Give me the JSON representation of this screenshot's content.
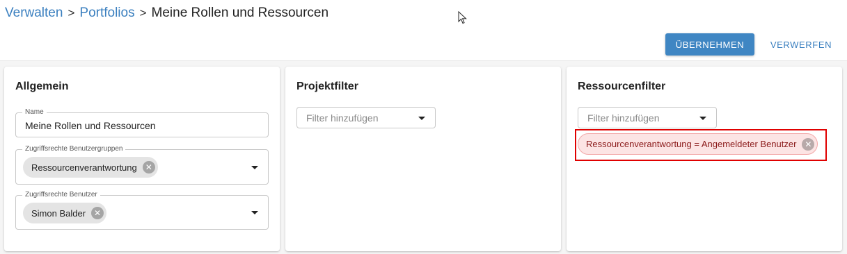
{
  "breadcrumb": {
    "items": [
      "Verwalten",
      "Portfolios"
    ],
    "separator": ">",
    "current": "Meine Rollen und Ressourcen"
  },
  "actions": {
    "apply_label": "ÜBERNEHMEN",
    "discard_label": "VERWERFEN"
  },
  "cards": {
    "general": {
      "title": "Allgemein",
      "name_field": {
        "label": "Name",
        "value": "Meine Rollen und Ressourcen"
      },
      "group_access_field": {
        "label": "Zugriffsrechte Benutzergruppen",
        "chips": [
          "Ressourcenverantwortung"
        ]
      },
      "user_access_field": {
        "label": "Zugriffsrechte Benutzer",
        "chips": [
          "Simon Balder"
        ]
      }
    },
    "project_filter": {
      "title": "Projektfilter",
      "placeholder": "Filter hinzufügen"
    },
    "resource_filter": {
      "title": "Ressourcenfilter",
      "placeholder": "Filter hinzufügen",
      "active_filters": [
        "Ressourcenverantwortung = Angemeldeter Benutzer"
      ]
    }
  },
  "colors": {
    "link": "#3a7fbf",
    "primary_button": "#3f86c3",
    "highlight": "#e00000",
    "chip_bg": "#e4e4e4",
    "filter_chip_bg": "#fce4e4"
  },
  "icons": {
    "chip_remove": "close-circle-icon",
    "dropdown": "caret-down-icon",
    "cursor": "mouse-pointer-icon"
  }
}
